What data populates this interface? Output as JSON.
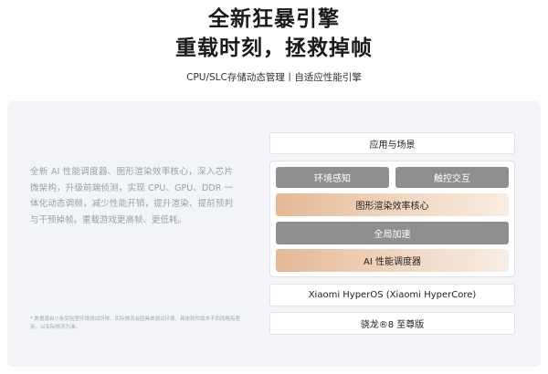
{
  "header": {
    "title_line1": "全新狂暴引擎",
    "title_line2": "重载时刻，拯救掉帧",
    "subtitle": "CPU/SLC存储动态管理丨自适应性能引擎"
  },
  "description": "全新 AI 性能调度器、图形渲染效率核心，深入芯片微架构，升级前端侦测，实现 CPU、GPU、DDR 一体化动态调频，减少性能开销，提升渲染、提前预判与干预掉帧。重载游戏更高帧、更低耗。",
  "footnote": "* 数据源自小米实验室环境测试所得，实际情况会因具体测试环境、具体软件版本不同而略有差别，以实际情况为准。",
  "diagram": {
    "app_layer": "应用与场景",
    "env_sense": "环境感知",
    "touch_interaction": "触控交互",
    "graphics_core": "图形渲染效率核心",
    "global_accel": "全局加速",
    "ai_scheduler": "AI 性能调度器",
    "os_layer": "Xiaomi HyperOS (Xiaomi HyperCore)",
    "chip_layer": "骁龙®8 至尊版"
  },
  "colors": {
    "gray_block": "#8f8f8f",
    "peach_start": "#e4b896",
    "peach_end": "#f8ede4",
    "card_bg": "#f2f4f8"
  }
}
